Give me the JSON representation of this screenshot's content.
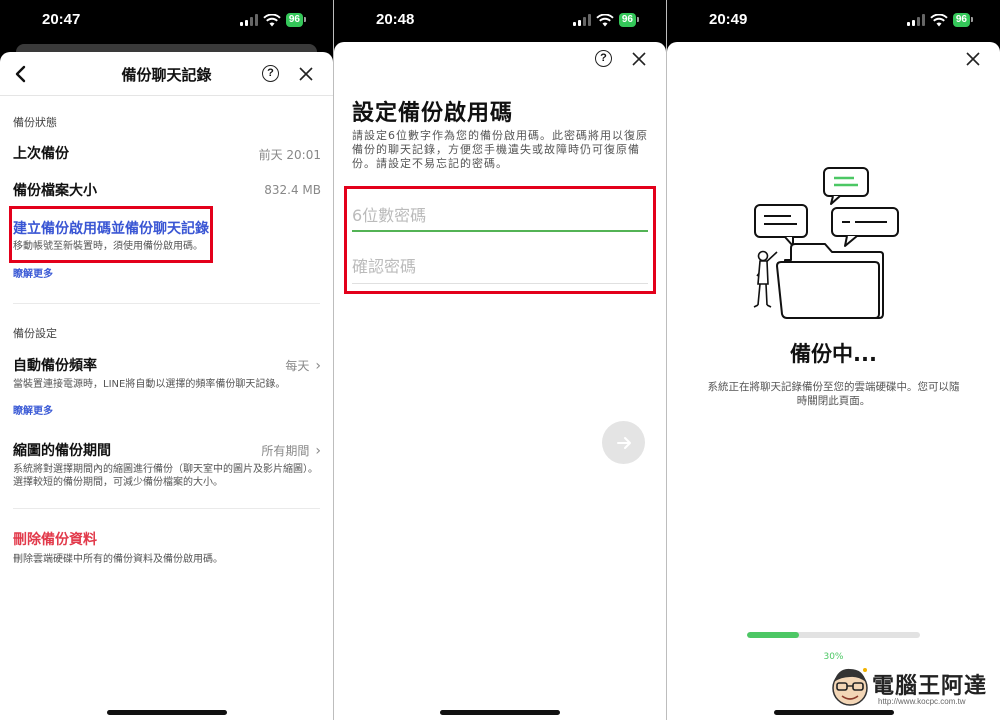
{
  "status_bars": [
    {
      "time": "20:47",
      "battery": "96"
    },
    {
      "time": "20:48",
      "battery": "96"
    },
    {
      "time": "20:49",
      "battery": "96"
    }
  ],
  "backup_screen": {
    "title": "備份聊天記錄",
    "status_section_label": "備份狀態",
    "last_backup_label": "上次備份",
    "last_backup_value": "前天 20:01",
    "file_size_label": "備份檔案大小",
    "file_size_value": "832.4 MB",
    "create_pin_label": "建立備份啟用碼並備份聊天記錄",
    "create_pin_desc": "移動帳號至新裝置時，須使用備份啟用碼。",
    "learn_more_1": "瞭解更多",
    "settings_section_label": "備份設定",
    "auto_backup_label": "自動備份頻率",
    "auto_backup_value": "每天",
    "auto_backup_desc": "當裝置連接電源時，LINE將自動以選擇的頻率備份聊天記錄。",
    "learn_more_2": "瞭解更多",
    "thumbnail_label": "縮圖的備份期間",
    "thumbnail_value": "所有期間",
    "thumbnail_desc": "系統將對選擇期間內的縮圖進行備份（聊天室中的圖片及影片縮圖）。選擇較短的備份期間，可減少備份檔案的大小。",
    "delete_label": "刪除備份資料",
    "delete_desc": "刪除雲端硬碟中所有的備份資料及備份啟用碼。"
  },
  "pin_screen": {
    "title": "設定備份啟用碼",
    "description": "請設定6位數字作為您的備份啟用碼。此密碼將用以復原備份的聊天記錄，方便您手機遺失或故障時仍可復原備份。請設定不易忘記的密碼。",
    "pin_placeholder": "6位數密碼",
    "confirm_placeholder": "確認密碼"
  },
  "progress_screen": {
    "title": "備份中...",
    "description": "系統正在將聊天記錄備份至您的雲端硬碟中。您可以隨時關閉此頁面。",
    "progress_percent": 30,
    "progress_label": "30%"
  },
  "watermark": {
    "text": "電腦王阿達",
    "url": "http://www.kocpc.com.tw"
  },
  "colors": {
    "link_blue": "#3a56d4",
    "danger_red": "#e23a4b",
    "line_green": "#4cc764",
    "highlight_red": "#e3001b"
  }
}
